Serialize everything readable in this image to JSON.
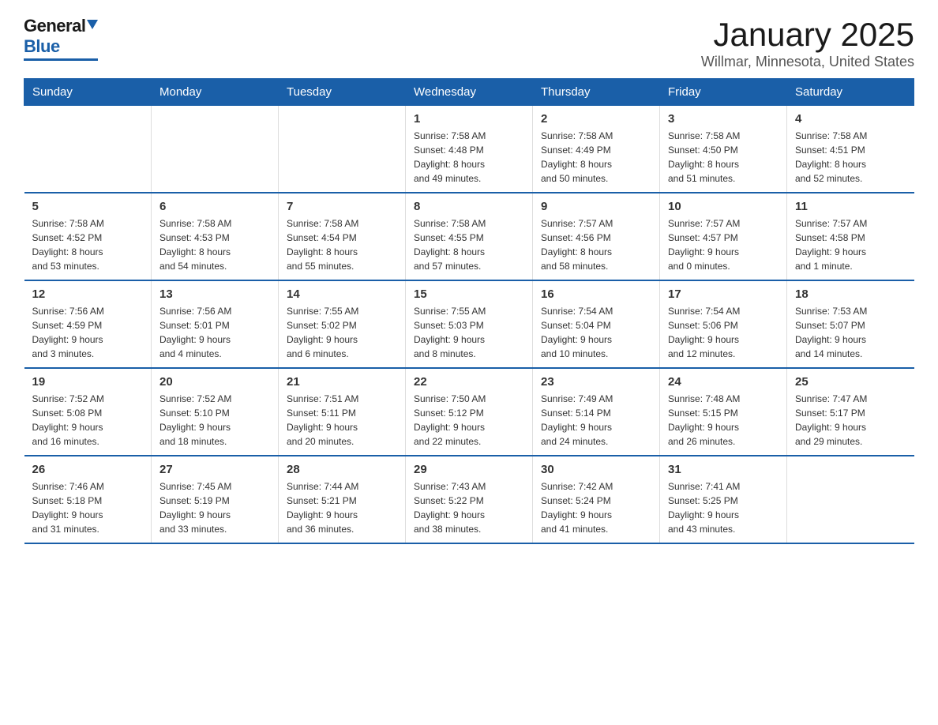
{
  "logo": {
    "general": "General",
    "blue": "Blue"
  },
  "title": "January 2025",
  "subtitle": "Willmar, Minnesota, United States",
  "days_of_week": [
    "Sunday",
    "Monday",
    "Tuesday",
    "Wednesday",
    "Thursday",
    "Friday",
    "Saturday"
  ],
  "weeks": [
    [
      {
        "day": "",
        "info": ""
      },
      {
        "day": "",
        "info": ""
      },
      {
        "day": "",
        "info": ""
      },
      {
        "day": "1",
        "info": "Sunrise: 7:58 AM\nSunset: 4:48 PM\nDaylight: 8 hours\nand 49 minutes."
      },
      {
        "day": "2",
        "info": "Sunrise: 7:58 AM\nSunset: 4:49 PM\nDaylight: 8 hours\nand 50 minutes."
      },
      {
        "day": "3",
        "info": "Sunrise: 7:58 AM\nSunset: 4:50 PM\nDaylight: 8 hours\nand 51 minutes."
      },
      {
        "day": "4",
        "info": "Sunrise: 7:58 AM\nSunset: 4:51 PM\nDaylight: 8 hours\nand 52 minutes."
      }
    ],
    [
      {
        "day": "5",
        "info": "Sunrise: 7:58 AM\nSunset: 4:52 PM\nDaylight: 8 hours\nand 53 minutes."
      },
      {
        "day": "6",
        "info": "Sunrise: 7:58 AM\nSunset: 4:53 PM\nDaylight: 8 hours\nand 54 minutes."
      },
      {
        "day": "7",
        "info": "Sunrise: 7:58 AM\nSunset: 4:54 PM\nDaylight: 8 hours\nand 55 minutes."
      },
      {
        "day": "8",
        "info": "Sunrise: 7:58 AM\nSunset: 4:55 PM\nDaylight: 8 hours\nand 57 minutes."
      },
      {
        "day": "9",
        "info": "Sunrise: 7:57 AM\nSunset: 4:56 PM\nDaylight: 8 hours\nand 58 minutes."
      },
      {
        "day": "10",
        "info": "Sunrise: 7:57 AM\nSunset: 4:57 PM\nDaylight: 9 hours\nand 0 minutes."
      },
      {
        "day": "11",
        "info": "Sunrise: 7:57 AM\nSunset: 4:58 PM\nDaylight: 9 hours\nand 1 minute."
      }
    ],
    [
      {
        "day": "12",
        "info": "Sunrise: 7:56 AM\nSunset: 4:59 PM\nDaylight: 9 hours\nand 3 minutes."
      },
      {
        "day": "13",
        "info": "Sunrise: 7:56 AM\nSunset: 5:01 PM\nDaylight: 9 hours\nand 4 minutes."
      },
      {
        "day": "14",
        "info": "Sunrise: 7:55 AM\nSunset: 5:02 PM\nDaylight: 9 hours\nand 6 minutes."
      },
      {
        "day": "15",
        "info": "Sunrise: 7:55 AM\nSunset: 5:03 PM\nDaylight: 9 hours\nand 8 minutes."
      },
      {
        "day": "16",
        "info": "Sunrise: 7:54 AM\nSunset: 5:04 PM\nDaylight: 9 hours\nand 10 minutes."
      },
      {
        "day": "17",
        "info": "Sunrise: 7:54 AM\nSunset: 5:06 PM\nDaylight: 9 hours\nand 12 minutes."
      },
      {
        "day": "18",
        "info": "Sunrise: 7:53 AM\nSunset: 5:07 PM\nDaylight: 9 hours\nand 14 minutes."
      }
    ],
    [
      {
        "day": "19",
        "info": "Sunrise: 7:52 AM\nSunset: 5:08 PM\nDaylight: 9 hours\nand 16 minutes."
      },
      {
        "day": "20",
        "info": "Sunrise: 7:52 AM\nSunset: 5:10 PM\nDaylight: 9 hours\nand 18 minutes."
      },
      {
        "day": "21",
        "info": "Sunrise: 7:51 AM\nSunset: 5:11 PM\nDaylight: 9 hours\nand 20 minutes."
      },
      {
        "day": "22",
        "info": "Sunrise: 7:50 AM\nSunset: 5:12 PM\nDaylight: 9 hours\nand 22 minutes."
      },
      {
        "day": "23",
        "info": "Sunrise: 7:49 AM\nSunset: 5:14 PM\nDaylight: 9 hours\nand 24 minutes."
      },
      {
        "day": "24",
        "info": "Sunrise: 7:48 AM\nSunset: 5:15 PM\nDaylight: 9 hours\nand 26 minutes."
      },
      {
        "day": "25",
        "info": "Sunrise: 7:47 AM\nSunset: 5:17 PM\nDaylight: 9 hours\nand 29 minutes."
      }
    ],
    [
      {
        "day": "26",
        "info": "Sunrise: 7:46 AM\nSunset: 5:18 PM\nDaylight: 9 hours\nand 31 minutes."
      },
      {
        "day": "27",
        "info": "Sunrise: 7:45 AM\nSunset: 5:19 PM\nDaylight: 9 hours\nand 33 minutes."
      },
      {
        "day": "28",
        "info": "Sunrise: 7:44 AM\nSunset: 5:21 PM\nDaylight: 9 hours\nand 36 minutes."
      },
      {
        "day": "29",
        "info": "Sunrise: 7:43 AM\nSunset: 5:22 PM\nDaylight: 9 hours\nand 38 minutes."
      },
      {
        "day": "30",
        "info": "Sunrise: 7:42 AM\nSunset: 5:24 PM\nDaylight: 9 hours\nand 41 minutes."
      },
      {
        "day": "31",
        "info": "Sunrise: 7:41 AM\nSunset: 5:25 PM\nDaylight: 9 hours\nand 43 minutes."
      },
      {
        "day": "",
        "info": ""
      }
    ]
  ]
}
